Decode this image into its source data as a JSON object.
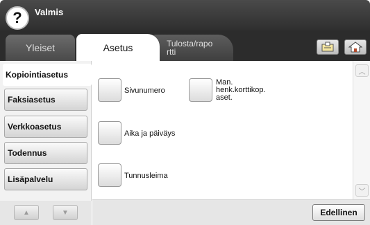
{
  "header": {
    "status": "Valmis",
    "help_icon": "?"
  },
  "tabs": [
    {
      "label": "Yleiset"
    },
    {
      "label": "Asetus"
    },
    {
      "label": "Tulosta/rapo\nrtti"
    }
  ],
  "toolbar": {
    "icons": [
      "job-status-icon",
      "home-icon"
    ]
  },
  "menu": {
    "items": [
      {
        "label": "Kopiointiasetus"
      },
      {
        "label": "Faksiasetus"
      },
      {
        "label": "Verkkoasetus"
      },
      {
        "label": "Todennus"
      },
      {
        "label": "Lisäpalvelu"
      }
    ]
  },
  "options": [
    {
      "label": "Sivunumero"
    },
    {
      "label": "Man.\nhenk.korttikop.\naset."
    },
    {
      "label": "Aika ja päiväys"
    },
    {
      "label": "Tunnusleima"
    }
  ],
  "footer": {
    "back_label": "Edellinen"
  }
}
